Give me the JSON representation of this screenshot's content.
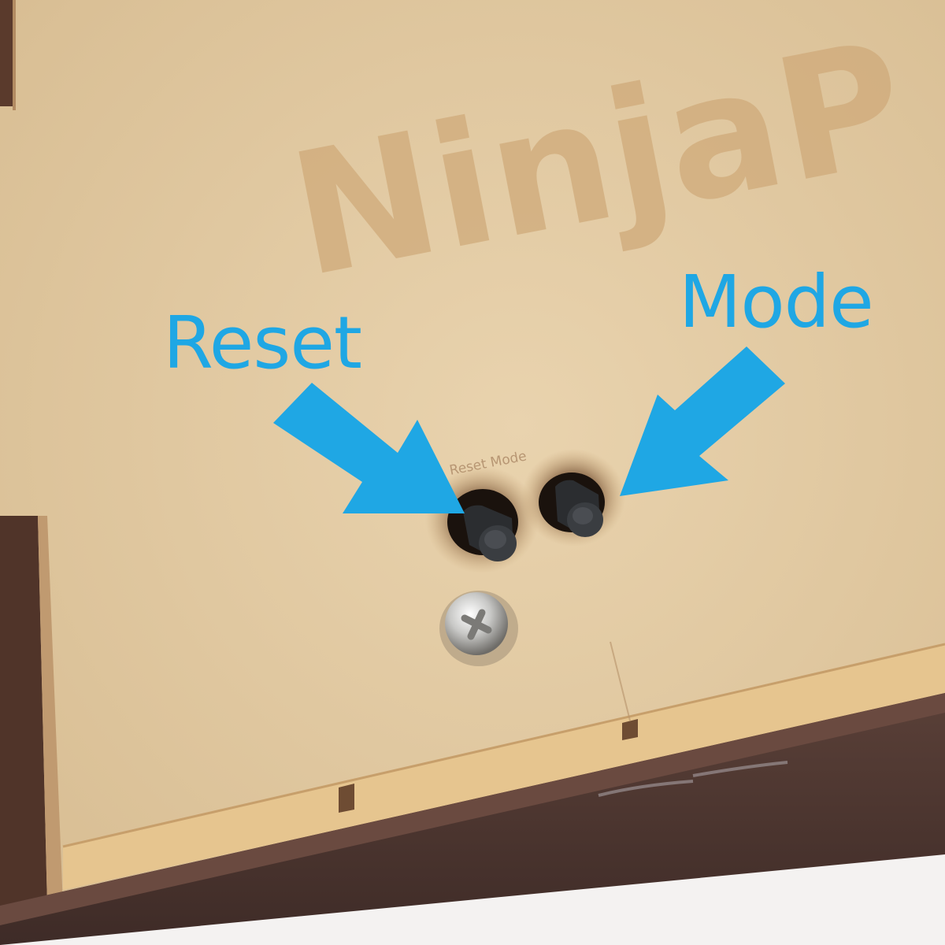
{
  "engraving": {
    "brand_text": "NinjaP",
    "button_labels": "Reset Mode"
  },
  "callouts": {
    "reset": "Reset",
    "mode": "Mode"
  },
  "colors": {
    "callout_blue": "#1fa7e4",
    "mdf_panel": "#e2c9a2",
    "dark_wood_edge": "#4e3832",
    "button_black": "#26292c"
  }
}
